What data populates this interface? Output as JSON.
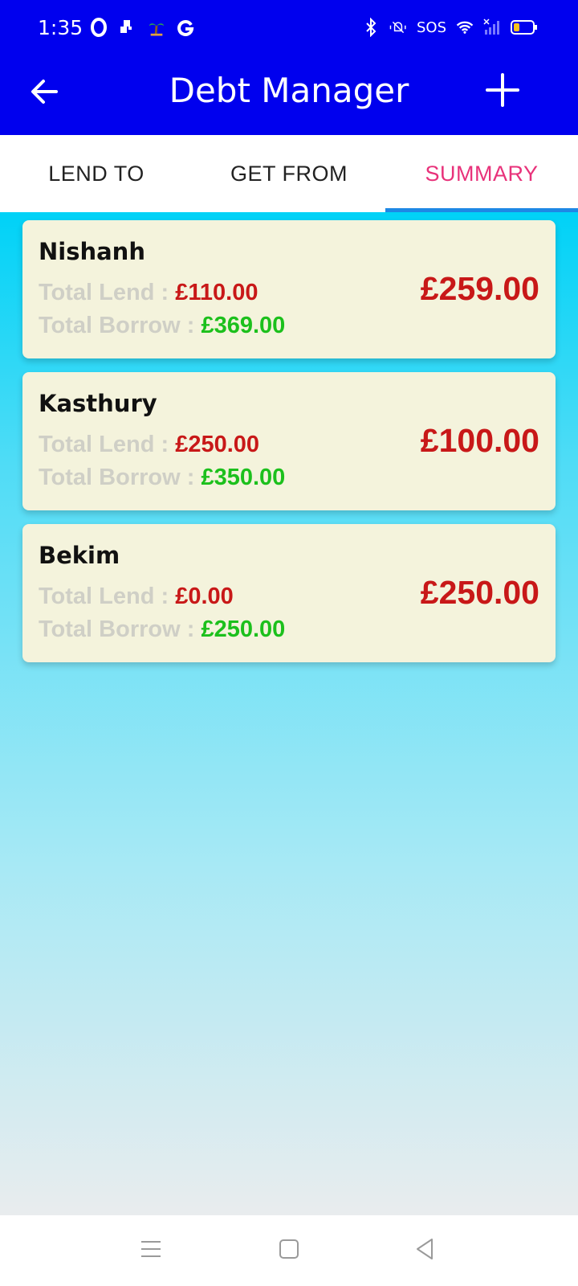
{
  "status_bar": {
    "time": "1:35",
    "sos": "SOS",
    "left_icons": [
      "opera-icon",
      "notification-icon",
      "palm-tree-icon",
      "google-icon"
    ],
    "right_icons": [
      "bluetooth-icon",
      "vibrate-mute-icon",
      "wifi-icon",
      "signal-icon",
      "battery-icon"
    ]
  },
  "app_bar": {
    "title": "Debt Manager"
  },
  "tabs": [
    {
      "label": "LEND TO",
      "active": false
    },
    {
      "label": "GET FROM",
      "active": false
    },
    {
      "label": "SUMMARY",
      "active": true
    }
  ],
  "summary_cards": [
    {
      "name": "Nishanh",
      "lend_label": "Total Lend : ",
      "lend_value": "£110.00",
      "borrow_label": "Total Borrow : ",
      "borrow_value": "£369.00",
      "total": "£259.00"
    },
    {
      "name": "Kasthury",
      "lend_label": "Total Lend : ",
      "lend_value": "£250.00",
      "borrow_label": "Total Borrow : ",
      "borrow_value": "£350.00",
      "total": "£100.00"
    },
    {
      "name": "Bekim",
      "lend_label": "Total Lend : ",
      "lend_value": "£0.00",
      "borrow_label": "Total Borrow : ",
      "borrow_value": "£250.00",
      "total": "£250.00"
    }
  ],
  "colors": {
    "app_bar": "#0000ee",
    "active_tab": "#e8327a",
    "tab_indicator": "#1e88e5",
    "lend_value": "#c81818",
    "borrow_value": "#1cc01c",
    "card_bg": "#f4f3dc"
  }
}
